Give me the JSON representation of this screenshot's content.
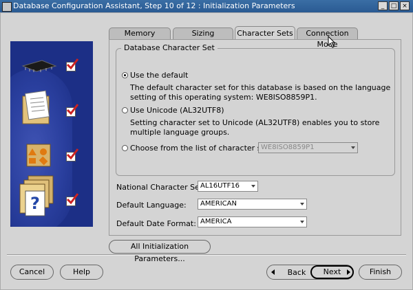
{
  "window": {
    "title": "Database Configuration Assistant, Step 10 of 12 : Initialization Parameters"
  },
  "tabs": [
    {
      "label": "Memory"
    },
    {
      "label": "Sizing"
    },
    {
      "label": "Character Sets",
      "active": true
    },
    {
      "label": "Connection Mode"
    }
  ],
  "charset_group": {
    "title": "Database Character Set",
    "options": [
      {
        "label": "Use the default",
        "selected": true,
        "desc": "The default character set for this database is based on the language setting of this operating system: WE8ISO8859P1."
      },
      {
        "label": "Use Unicode (AL32UTF8)",
        "selected": false,
        "desc": "Setting character set to Unicode (AL32UTF8) enables you to store multiple language groups."
      },
      {
        "label": "Choose from the list of character sets",
        "selected": false,
        "combo_value": "WE8ISO8859P1"
      }
    ]
  },
  "fields": {
    "national_charset": {
      "label": "National Character Set:",
      "value": "AL16UTF16"
    },
    "default_language": {
      "label": "Default Language:",
      "value": "AMERICAN"
    },
    "date_format": {
      "label": "Default Date Format:",
      "value": "AMERICA"
    }
  },
  "all_params_button": "All Initialization Parameters...",
  "footer": {
    "cancel": "Cancel",
    "help": "Help",
    "back": "Back",
    "next": "Next",
    "finish": "Finish"
  },
  "icons": [
    "chip-icon",
    "folder-icon",
    "shapes-icon",
    "help-folders-icon"
  ],
  "colors": {
    "panel": "#1c2f86",
    "titlebar": "#2a5a93",
    "check": "#cc2222"
  }
}
